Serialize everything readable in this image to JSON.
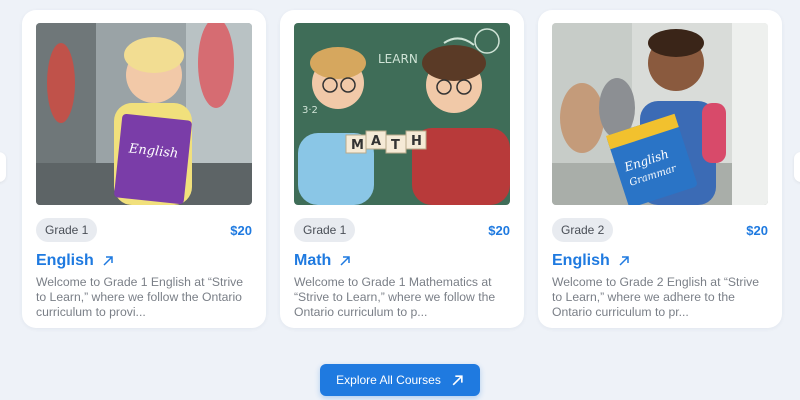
{
  "courses": [
    {
      "grade": "Grade 1",
      "price": "$20",
      "title": "English",
      "description": "Welcome to Grade 1 English at “Strive to Learn,” where we follow the Ontario curriculum to provi...",
      "image_icon": "student-with-english-book-photo"
    },
    {
      "grade": "Grade 1",
      "price": "$20",
      "title": "Math",
      "description": "Welcome to Grade 1 Mathematics at “Strive to Learn,” where we follow the Ontario curriculum to p...",
      "image_icon": "students-with-math-blocks-photo"
    },
    {
      "grade": "Grade 2",
      "price": "$20",
      "title": "English",
      "description": "Welcome to Grade 2 English at “Strive to Learn,” where we adhere to the Ontario curriculum to pr...",
      "image_icon": "student-with-english-grammar-book-photo"
    }
  ],
  "explore_button": {
    "label": "Explore All Courses",
    "icon": "arrow-up-right-icon"
  },
  "colors": {
    "accent": "#1f7ae0",
    "background": "#eef2f8",
    "badge": "#e8ebf0"
  }
}
